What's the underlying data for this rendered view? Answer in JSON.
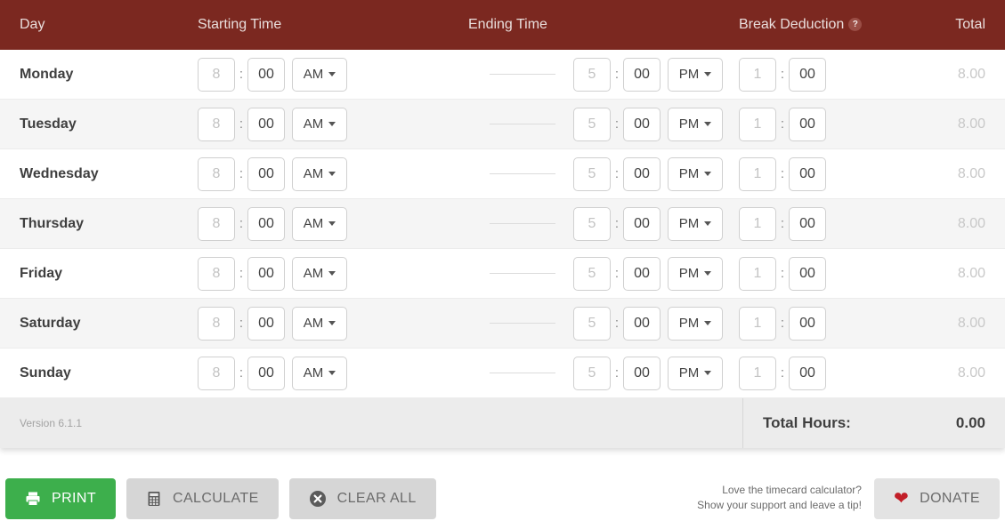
{
  "header": {
    "day": "Day",
    "starting_time": "Starting Time",
    "ending_time": "Ending Time",
    "break_deduction": "Break Deduction",
    "help": "?",
    "total": "Total",
    "bg_color": "#7b2820"
  },
  "rows": [
    {
      "day": "Monday",
      "start_hour": "8",
      "start_min": "00",
      "start_ampm": "AM",
      "end_hour": "5",
      "end_min": "00",
      "end_ampm": "PM",
      "break_hour": "1",
      "break_min": "00",
      "total": "8.00"
    },
    {
      "day": "Tuesday",
      "start_hour": "8",
      "start_min": "00",
      "start_ampm": "AM",
      "end_hour": "5",
      "end_min": "00",
      "end_ampm": "PM",
      "break_hour": "1",
      "break_min": "00",
      "total": "8.00"
    },
    {
      "day": "Wednesday",
      "start_hour": "8",
      "start_min": "00",
      "start_ampm": "AM",
      "end_hour": "5",
      "end_min": "00",
      "end_ampm": "PM",
      "break_hour": "1",
      "break_min": "00",
      "total": "8.00"
    },
    {
      "day": "Thursday",
      "start_hour": "8",
      "start_min": "00",
      "start_ampm": "AM",
      "end_hour": "5",
      "end_min": "00",
      "end_ampm": "PM",
      "break_hour": "1",
      "break_min": "00",
      "total": "8.00"
    },
    {
      "day": "Friday",
      "start_hour": "8",
      "start_min": "00",
      "start_ampm": "AM",
      "end_hour": "5",
      "end_min": "00",
      "end_ampm": "PM",
      "break_hour": "1",
      "break_min": "00",
      "total": "8.00"
    },
    {
      "day": "Saturday",
      "start_hour": "8",
      "start_min": "00",
      "start_ampm": "AM",
      "end_hour": "5",
      "end_min": "00",
      "end_ampm": "PM",
      "break_hour": "1",
      "break_min": "00",
      "total": "8.00"
    },
    {
      "day": "Sunday",
      "start_hour": "8",
      "start_min": "00",
      "start_ampm": "AM",
      "end_hour": "5",
      "end_min": "00",
      "end_ampm": "PM",
      "break_hour": "1",
      "break_min": "00",
      "total": "8.00"
    }
  ],
  "separator": ":",
  "footer": {
    "version": "Version 6.1.1",
    "total_hours_label": "Total Hours:",
    "total_hours_value": "0.00"
  },
  "actions": {
    "print": "PRINT",
    "calculate": "CALCULATE",
    "clear_all": "CLEAR ALL",
    "donate": "DONATE",
    "print_color": "#3daf4c",
    "heart_color": "#c21f28"
  },
  "tip": {
    "line1": "Love the timecard calculator?",
    "line2": "Show your support and leave a tip!"
  }
}
